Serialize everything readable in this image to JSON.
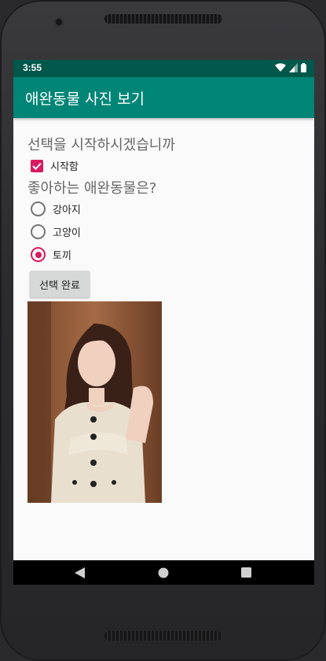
{
  "status": {
    "time": "3:55"
  },
  "app": {
    "title": "애완동물 사진 보기"
  },
  "form": {
    "start_question": "선택을 시작하시겠습니까",
    "start_checkbox": {
      "label": "시작함",
      "checked": true
    },
    "pet_question": "좋아하는 애완동물은?",
    "options": [
      {
        "label": "강아지",
        "selected": false
      },
      {
        "label": "고양이",
        "selected": false
      },
      {
        "label": "토끼",
        "selected": true
      }
    ],
    "submit_label": "선택 완료"
  },
  "colors": {
    "statusbar": "#00574b",
    "appbar": "#008577",
    "accent": "#d81b60"
  },
  "icons": [
    "wifi-icon",
    "cell-signal-icon",
    "battery-icon",
    "back-icon",
    "home-icon",
    "recents-icon"
  ]
}
